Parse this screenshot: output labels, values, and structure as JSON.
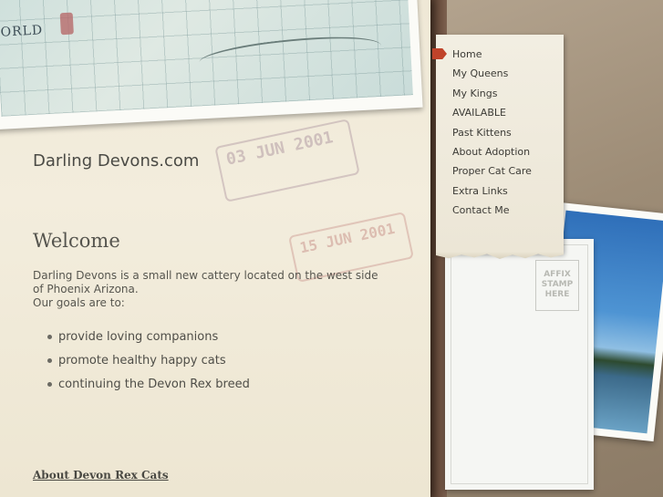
{
  "site": {
    "title": "Darling Devons.com"
  },
  "map": {
    "label": "ORLD"
  },
  "stamps": {
    "stamp1": "03 JUN 2001",
    "stamp2": "15 JUN 2001"
  },
  "main": {
    "heading": "Welcome",
    "intro_line1": "Darling Devons is a small new cattery located on the west side of Phoenix Arizona.",
    "intro_line2": "Our goals are to:",
    "goals": [
      "provide loving companions",
      "promote healthy happy cats",
      "continuing the Devon Rex breed"
    ],
    "about_link": "About Devon Rex Cats"
  },
  "nav": {
    "items": [
      "Home",
      "My Queens",
      "My Kings",
      "AVAILABLE",
      "Past Kittens",
      "About Adoption",
      "Proper Cat Care",
      "Extra Links",
      "Contact Me"
    ],
    "active_index": 0,
    "marker_color": "#c0432a"
  },
  "postcard": {
    "stamp_line1": "AFFIX",
    "stamp_line2": "STAMP",
    "stamp_line3": "HERE"
  }
}
